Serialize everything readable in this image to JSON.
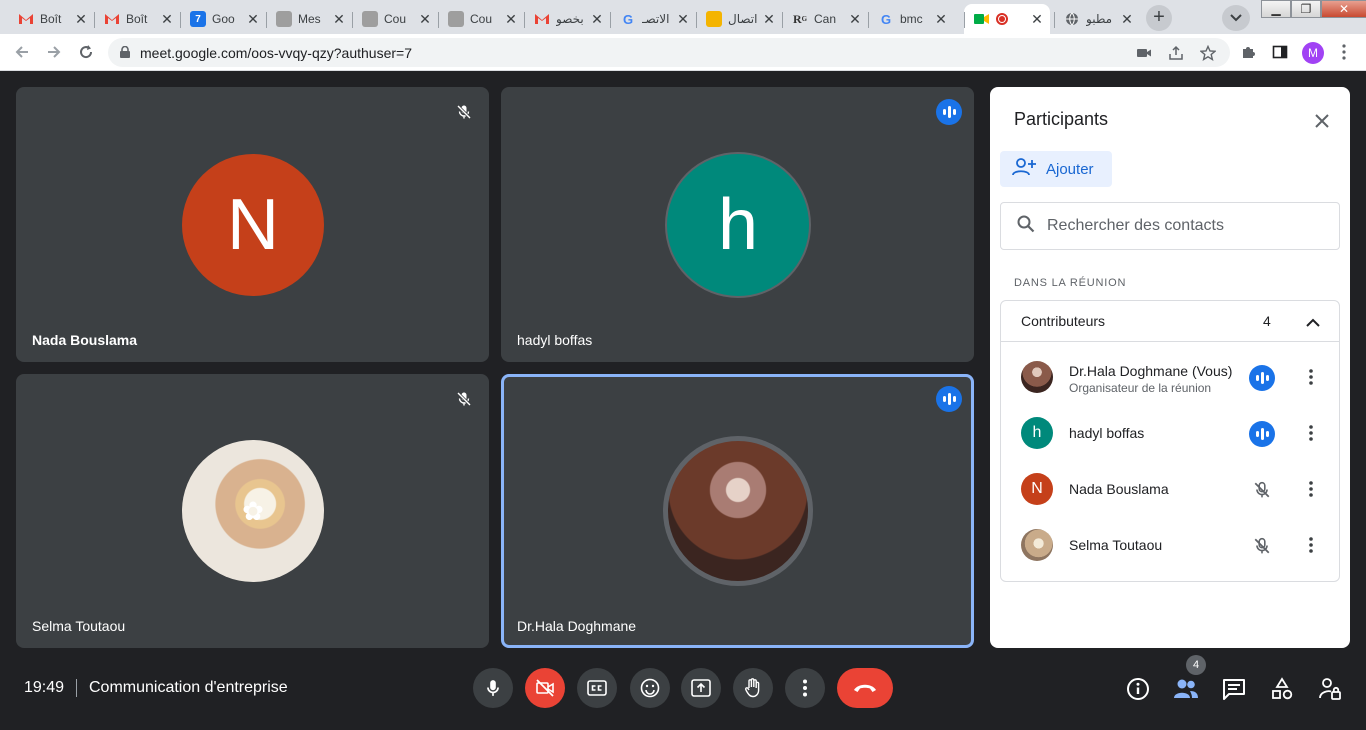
{
  "browser": {
    "tabs": [
      {
        "title": "Boît",
        "favicon": "gmail-icon"
      },
      {
        "title": "Boît",
        "favicon": "gmail-icon"
      },
      {
        "title": "Goo",
        "favicon": "google-calendar-icon"
      },
      {
        "title": "Mes",
        "favicon": "page-icon"
      },
      {
        "title": "Cou",
        "favicon": "page-icon"
      },
      {
        "title": "Cou",
        "favicon": "page-icon"
      },
      {
        "title": "بخصو",
        "favicon": "gmail-icon"
      },
      {
        "title": "الاتصـ",
        "favicon": "google-icon"
      },
      {
        "title": "اتصال",
        "favicon": "page-icon"
      },
      {
        "title": "Can",
        "favicon": "researchgate-icon"
      },
      {
        "title": "bmc",
        "favicon": "google-icon"
      },
      {
        "title": "",
        "favicon": "google-meet-icon"
      },
      {
        "title": "مطبو",
        "favicon": "globe-icon"
      }
    ],
    "url": "meet.google.com/oos-vvqy-qzy?authuser=7",
    "profile_initial": "M"
  },
  "tiles": [
    {
      "name": "Nada Bouslama",
      "initial": "N",
      "avatar_color": "#c5401a",
      "status": "muted"
    },
    {
      "name": "hadyl boffas",
      "initial": "h",
      "avatar_color": "#00897b",
      "status": "speaking"
    },
    {
      "name": "Selma Toutaou",
      "initial": "",
      "avatar_color": "#d9cfc0",
      "status": "muted"
    },
    {
      "name": "Dr.Hala Doghmane",
      "initial": "",
      "avatar_color": "#6b3a2a",
      "status": "speaking"
    }
  ],
  "panel": {
    "title": "Participants",
    "add_label": "Ajouter",
    "search_placeholder": "Rechercher des contacts",
    "section_label": "DANS LA RÉUNION",
    "group_label": "Contributeurs",
    "group_count": "4",
    "participants": [
      {
        "name": "Dr.Hala Doghmane (Vous)",
        "subtitle": "Organisateur de la réunion",
        "status": "speaking",
        "initial": "",
        "color": "#6b3a2a"
      },
      {
        "name": "hadyl boffas",
        "subtitle": "",
        "status": "speaking",
        "initial": "h",
        "color": "#00897b"
      },
      {
        "name": "Nada Bouslama",
        "subtitle": "",
        "status": "muted",
        "initial": "N",
        "color": "#c5401a"
      },
      {
        "name": "Selma Toutaou",
        "subtitle": "",
        "status": "muted",
        "initial": "",
        "color": "#b9a68c"
      }
    ]
  },
  "bottom": {
    "time": "19:49",
    "meeting_name": "Communication d'entreprise",
    "participants_badge": "4"
  },
  "colors": {
    "accent_blue": "#1a73e8",
    "end_call_red": "#ea4335",
    "tile_bg": "#3c4043",
    "app_bg": "#202124"
  }
}
